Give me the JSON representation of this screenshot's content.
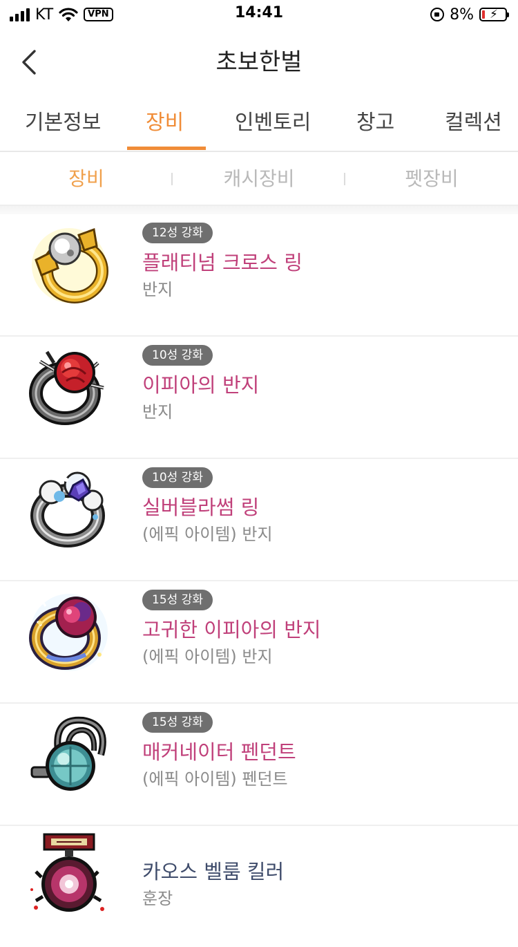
{
  "status_bar": {
    "carrier": "KT",
    "vpn_label": "VPN",
    "time": "14:41",
    "battery_percent": "8%",
    "icons": [
      "signal-icon",
      "wifi-icon",
      "vpn-icon",
      "rotation-lock-icon",
      "battery-charging-icon"
    ]
  },
  "header": {
    "title": "초보한벌",
    "back_icon": "chevron-left-icon"
  },
  "tabs": [
    {
      "label": "기본정보",
      "active": false
    },
    {
      "label": "장비",
      "active": true
    },
    {
      "label": "인벤토리",
      "active": false
    },
    {
      "label": "창고",
      "active": false
    },
    {
      "label": "컬렉션",
      "active": false
    }
  ],
  "subtabs": [
    {
      "label": "장비",
      "active": true
    },
    {
      "label": "캐시장비",
      "active": false
    },
    {
      "label": "펫장비",
      "active": false
    }
  ],
  "colors": {
    "accent": "#f08c37",
    "item_name": "#c0407a",
    "item_name_plain": "#3f4c6b",
    "badge_bg": "#6f6f6f"
  },
  "items": [
    {
      "badge": "12성 강화",
      "name": "플래티넘 크로스 링",
      "category": "반지",
      "icon": "platinum-cross-ring-icon"
    },
    {
      "badge": "10성 강화",
      "name": "이피아의 반지",
      "category": "반지",
      "icon": "ifia-ring-icon"
    },
    {
      "badge": "10성 강화",
      "name": "실버블라썸 링",
      "category": "(에픽 아이템) 반지",
      "icon": "silver-blossom-ring-icon"
    },
    {
      "badge": "15성 강화",
      "name": "고귀한 이피아의 반지",
      "category": "(에픽 아이템) 반지",
      "icon": "noble-ifia-ring-icon"
    },
    {
      "badge": "15성 강화",
      "name": "매커네이터 펜던트",
      "category": "(에픽 아이템) 펜던트",
      "icon": "mechanator-pendant-icon"
    },
    {
      "badge": "",
      "name": "카오스 벨룸 킬러",
      "category": "훈장",
      "icon": "chaos-vellum-killer-medal-icon"
    }
  ]
}
